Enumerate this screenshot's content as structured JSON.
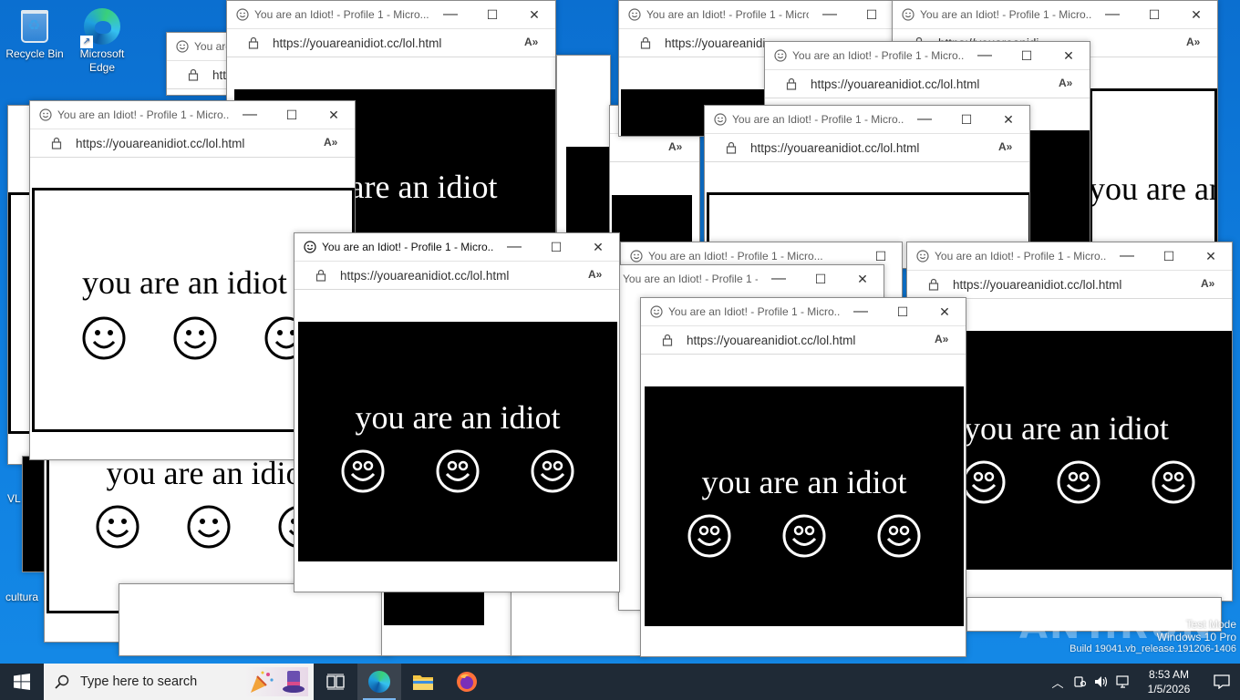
{
  "desktop": {
    "icons": [
      {
        "label": "Recycle Bin",
        "icon": "recycle-bin-icon"
      },
      {
        "label": "Microsoft Edge",
        "icon": "edge-icon"
      }
    ],
    "partial_icon_labels": [
      "VL",
      "cultura"
    ]
  },
  "browser": {
    "title": "You are an Idiot! - Profile 1 - Micro...",
    "title_variant": "You are an Idiot! - Profile 1 - Micros...",
    "url": "https://youareanidiot.cc/lol.html",
    "url_short": "https://youareanidi...",
    "phrase": "you are an idiot",
    "controls": {
      "minimize": "—",
      "maximize": "☐",
      "close": "✕"
    }
  },
  "taskbar": {
    "search_placeholder": "Type here to search",
    "apps": [
      "task-view-icon",
      "edge-icon",
      "file-explorer-icon",
      "firefox-icon"
    ],
    "clock": {
      "time": "8:53 AM",
      "date": "1/5/2026"
    }
  },
  "watermark": {
    "line1": "Test Mode",
    "line2": "Windows 10 Pro",
    "line3": "Build 19041.vb_release.191206-1406",
    "brand": "ANY.RUN"
  },
  "colors": {
    "desktop_blue": "#0b6fd0",
    "taskbar": "#1f2a36",
    "panel_black": "#000000"
  }
}
